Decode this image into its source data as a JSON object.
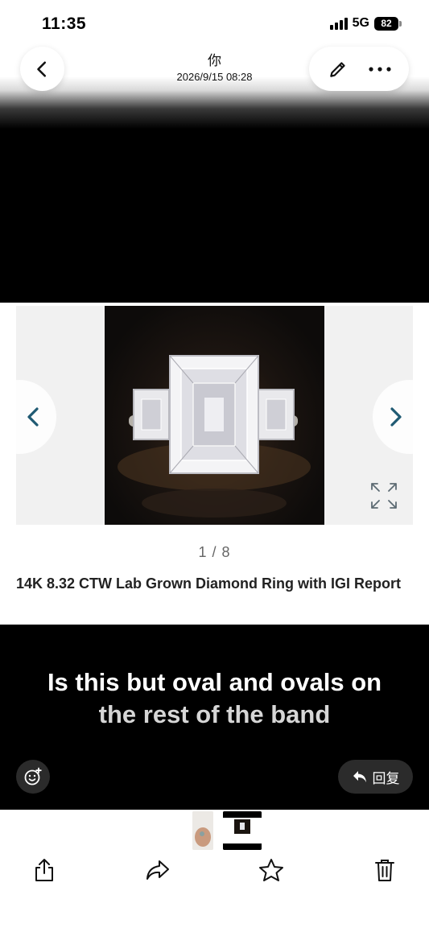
{
  "status_bar": {
    "time": "11:35",
    "network": "5G",
    "battery": "82"
  },
  "header": {
    "sender": "你",
    "datetime": "2026/9/15 08:28"
  },
  "content": {
    "counter": "1 / 8",
    "product_title": "14K 8.32 CTW Lab Grown Diamond Ring with IGI Report",
    "caption_line1": "Is this but oval and ovals on",
    "caption_line2": "the rest of the band"
  },
  "actions": {
    "reply_label": "回复"
  },
  "toolbar": {
    "items": [
      "share-icon",
      "forward-icon",
      "star-icon",
      "trash-icon"
    ]
  },
  "icons": {
    "back": "chevron-left-icon",
    "edit": "pencil-icon",
    "more": "more-icon",
    "emoji": "emoji-add-icon",
    "reply": "reply-arrow-icon"
  },
  "colors": {
    "accent_teal": "#1f5a73",
    "panel_bg": "#2b2b2b"
  }
}
